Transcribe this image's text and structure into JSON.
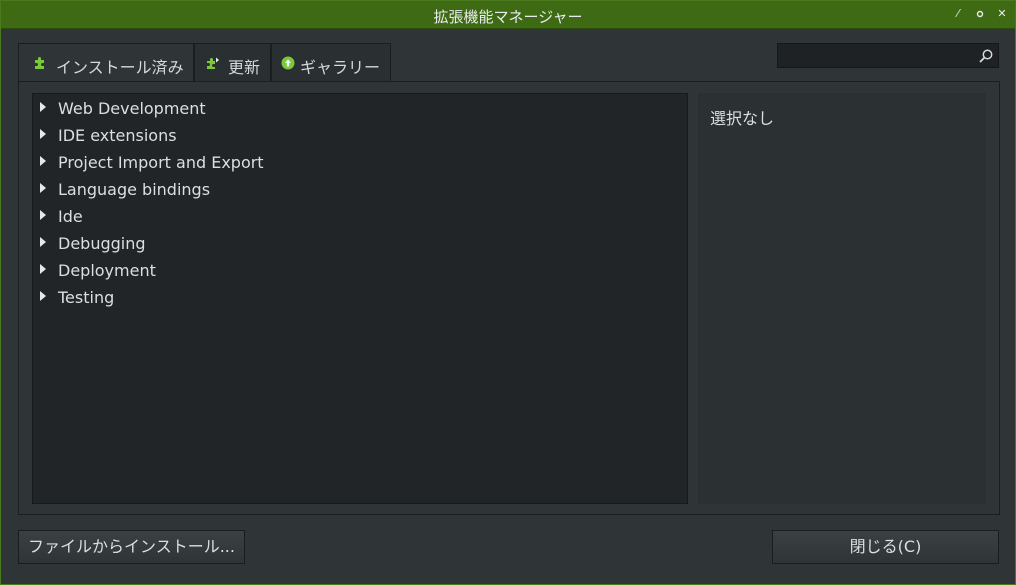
{
  "window": {
    "title": "拡張機能マネージャー",
    "controls": [
      "minimize",
      "maximize",
      "close"
    ]
  },
  "tabs": [
    {
      "label": "インストール済み",
      "icon": "puzzle-icon",
      "active": true
    },
    {
      "label": "更新",
      "icon": "update-puzzle-icon",
      "active": false
    },
    {
      "label": "ギャラリー",
      "icon": "gallery-up-arrow-icon",
      "active": false
    }
  ],
  "search": {
    "placeholder": "",
    "value": "",
    "icon": "search-icon"
  },
  "tree": {
    "items": [
      {
        "label": "Web Development"
      },
      {
        "label": "IDE extensions"
      },
      {
        "label": "Project Import and Export"
      },
      {
        "label": "Language bindings"
      },
      {
        "label": "Ide"
      },
      {
        "label": "Debugging"
      },
      {
        "label": "Deployment"
      },
      {
        "label": "Testing"
      }
    ]
  },
  "details": {
    "text": "選択なし"
  },
  "buttons": {
    "install_from_file": "ファイルからインストール...",
    "close": "閉じる(C)"
  },
  "colors": {
    "titlebar": "#3f6a14",
    "accent": "#7cc83a",
    "window_bg": "#2f3436",
    "tree_bg": "#212527"
  }
}
